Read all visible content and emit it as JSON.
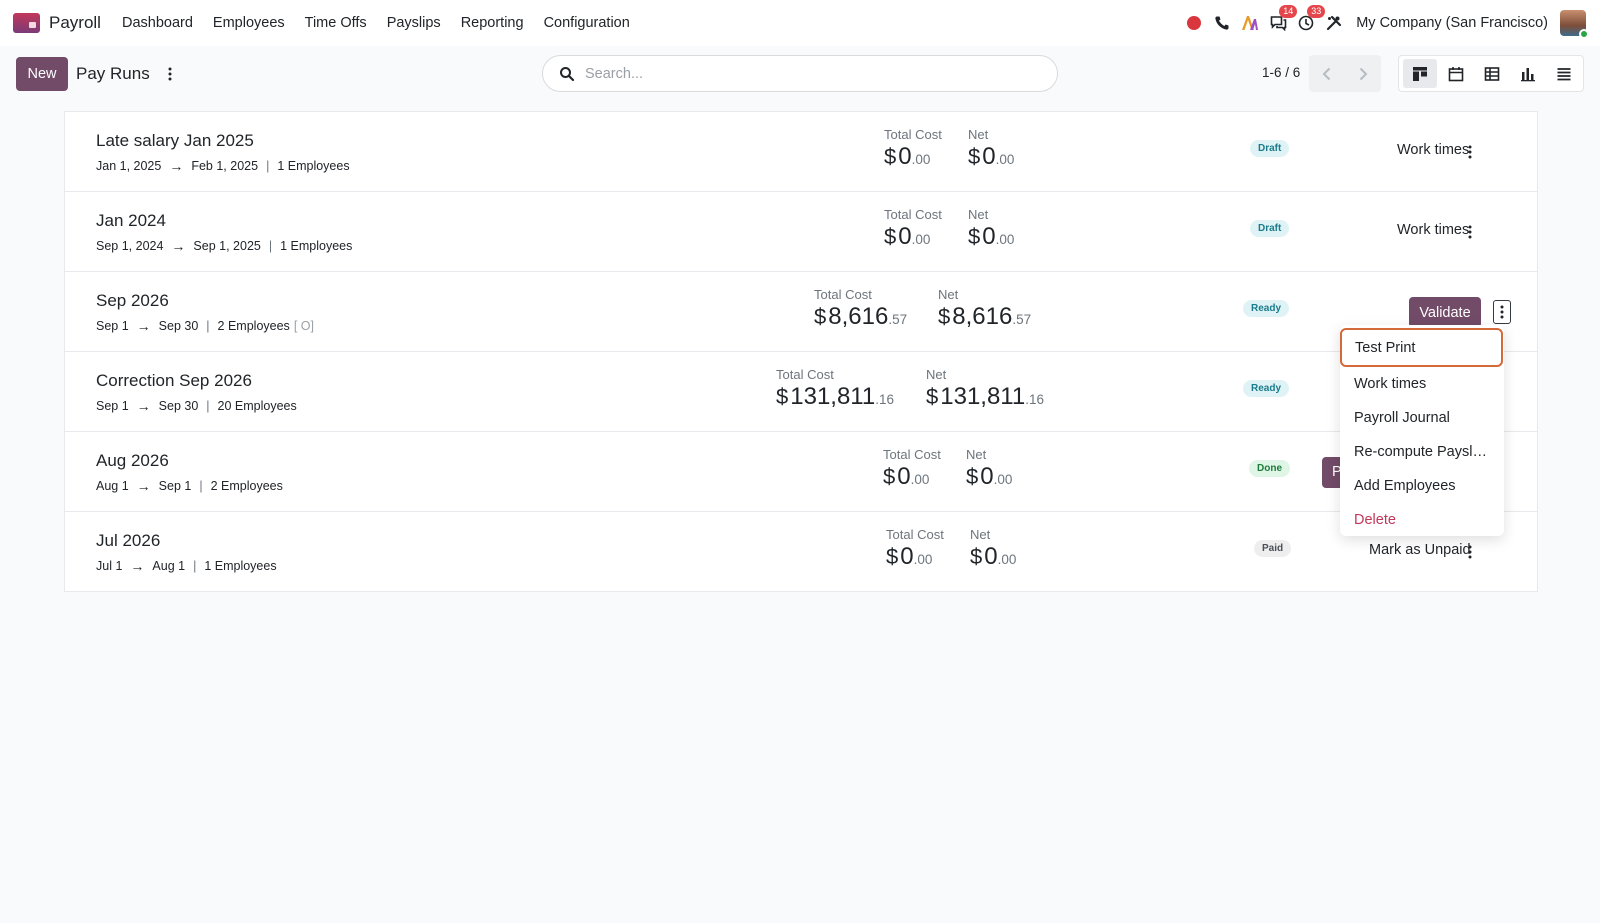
{
  "app": {
    "name": "Payroll"
  },
  "menu": [
    "Dashboard",
    "Employees",
    "Time Offs",
    "Payslips",
    "Reporting",
    "Configuration"
  ],
  "systray": {
    "messages_badge": "14",
    "activities_badge": "33",
    "company": "My Company (San Francisco)"
  },
  "control": {
    "new_label": "New",
    "title": "Pay Runs",
    "search_placeholder": "Search...",
    "pager": "1-6 / 6"
  },
  "labels": {
    "total_cost": "Total Cost",
    "net": "Net"
  },
  "cards": [
    {
      "title": "Late salary Jan 2025",
      "start": "Jan 1, 2025",
      "end": "Feb 1, 2025",
      "employees": "1 Employees",
      "extra": "",
      "total_whole": "0",
      "total_cents": ".00",
      "net_whole": "0",
      "net_cents": ".00",
      "status": "Draft",
      "action": "Work times"
    },
    {
      "title": "Jan 2024",
      "start": "Sep 1, 2024",
      "end": "Sep 1, 2025",
      "employees": "1 Employees",
      "extra": "",
      "total_whole": "0",
      "total_cents": ".00",
      "net_whole": "0",
      "net_cents": ".00",
      "status": "Draft",
      "action": "Work times"
    },
    {
      "title": "Sep 2026",
      "start": "Sep 1",
      "end": "Sep 30",
      "employees": "2 Employees",
      "extra": "[ O]",
      "total_whole": "8,616",
      "total_cents": ".57",
      "net_whole": "8,616",
      "net_cents": ".57",
      "status": "Ready",
      "action": "Validate"
    },
    {
      "title": "Correction Sep 2026",
      "start": "Sep 1",
      "end": "Sep 30",
      "employees": "20 Employees",
      "extra": "",
      "total_whole": "131,811",
      "total_cents": ".16",
      "net_whole": "131,811",
      "net_cents": ".16",
      "status": "Ready",
      "action": ""
    },
    {
      "title": "Aug 2026",
      "start": "Aug 1",
      "end": "Sep 1",
      "employees": "2 Employees",
      "extra": "",
      "total_whole": "0",
      "total_cents": ".00",
      "net_whole": "0",
      "net_cents": ".00",
      "status": "Done",
      "action": "P"
    },
    {
      "title": "Jul 2026",
      "start": "Jul 1",
      "end": "Aug 1",
      "employees": "1 Employees",
      "extra": "",
      "total_whole": "0",
      "total_cents": ".00",
      "net_whole": "0",
      "net_cents": ".00",
      "status": "Paid",
      "action": "Mark as Unpaid"
    }
  ],
  "currency": "$",
  "dropdown": {
    "items": [
      "Test Print",
      "Work times",
      "Payroll Journal",
      "Re-compute Paysl…",
      "Add Employees",
      "Delete"
    ]
  },
  "colors": {
    "primary": "#714b67",
    "focus_ring": "#d4693a",
    "danger": "#c2385a",
    "badge_red": "#e4464b"
  }
}
